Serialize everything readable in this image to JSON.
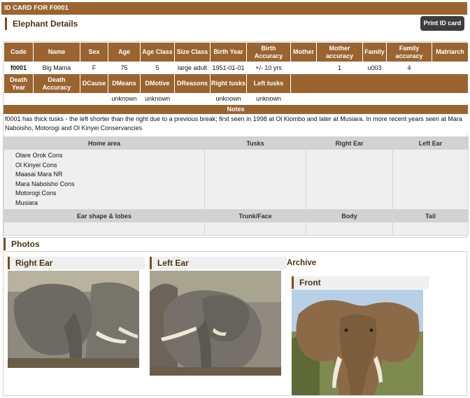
{
  "topbar": {
    "title": "ID CARD FOR F0001"
  },
  "header": {
    "section_title": "Elephant Details",
    "print_label": "Print ID card"
  },
  "details": {
    "row1_headers": [
      "Code",
      "Name",
      "Sex",
      "Age",
      "Age Class",
      "Size Class",
      "Birth Year",
      "Birth Accuracy",
      "Mother",
      "Mother accuracy",
      "Family",
      "Family accuracy",
      "Matriarch"
    ],
    "row1_values": [
      "f0001",
      "Big Mama",
      "F",
      "75",
      "5",
      "large adult",
      "1951-01-01",
      "+/- 10 yrs",
      "",
      "1",
      "u003",
      "4",
      ""
    ],
    "row2_headers": [
      "Death Year",
      "Death Accuracy",
      "DCause",
      "DMeans",
      "DMotive",
      "DReasons",
      "Right tusks",
      "Left tusks"
    ],
    "row2_values": [
      "",
      "",
      "",
      "unknown",
      "unknown",
      "",
      "unknown",
      "unknown"
    ]
  },
  "notes": {
    "label": "Notes",
    "text": "f0001 has thick tusks - the left shorter than the right due to a previous break; first seen in 1998 at Ol Kiombo and later at Musiara. In more recent years seen at Mara Naboisho, Motorogi and Ol Kinyei Conservancies"
  },
  "area_table": {
    "headers": [
      "Home area",
      "Tusks",
      "Right Ear",
      "Left Ear"
    ],
    "home_areas": [
      "Olare Orok Cons",
      "Ol Kinyei Cons",
      "Maasai Mara NR",
      "Mara Naboisho Cons",
      "Motorogi Cons",
      "Musiara"
    ],
    "headers2": [
      "Ear shape & lobes",
      "Trunk/Face",
      "Body",
      "Tail"
    ]
  },
  "photos": {
    "section_title": "Photos",
    "right_ear": "Right Ear",
    "left_ear": "Left Ear",
    "archive": "Archive",
    "front": "Front"
  },
  "colors": {
    "brand": "#9a6431",
    "accent_dark": "#4a3413"
  }
}
